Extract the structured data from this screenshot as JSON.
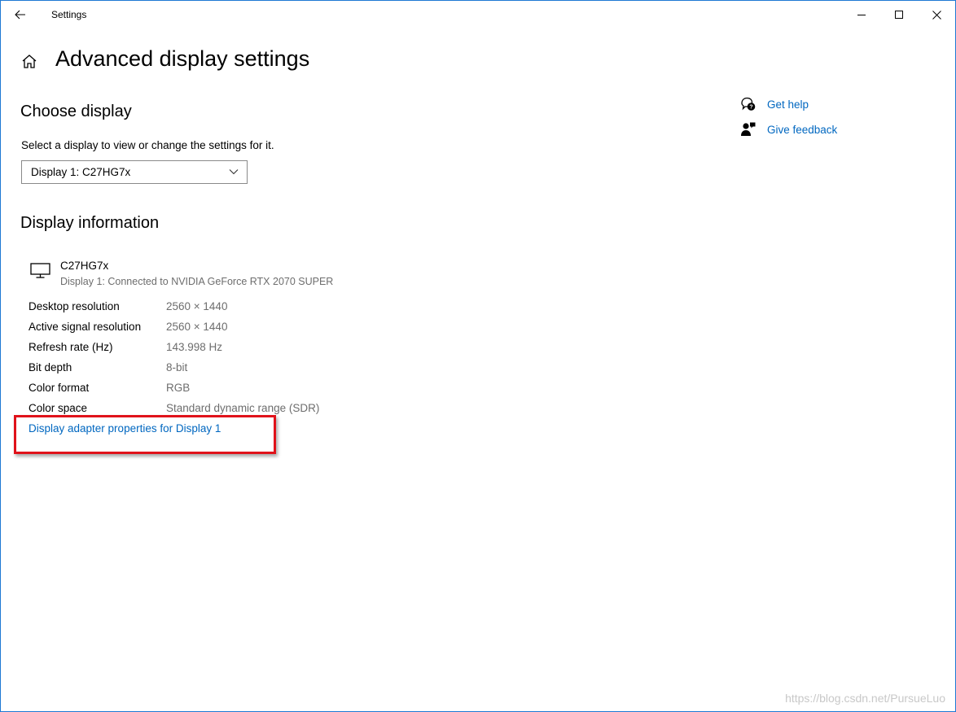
{
  "window": {
    "title": "Settings"
  },
  "page": {
    "title": "Advanced display settings"
  },
  "choose_display": {
    "heading": "Choose display",
    "description": "Select a display to view or change the settings for it.",
    "selected": "Display 1: C27HG7x"
  },
  "display_info": {
    "heading": "Display information",
    "monitor_name": "C27HG7x",
    "monitor_subtitle": "Display 1: Connected to NVIDIA GeForce RTX 2070 SUPER",
    "rows": [
      {
        "label": "Desktop resolution",
        "value": "2560 × 1440"
      },
      {
        "label": "Active signal resolution",
        "value": "2560 × 1440"
      },
      {
        "label": "Refresh rate (Hz)",
        "value": "143.998 Hz"
      },
      {
        "label": "Bit depth",
        "value": "8-bit"
      },
      {
        "label": "Color format",
        "value": "RGB"
      },
      {
        "label": "Color space",
        "value": "Standard dynamic range (SDR)"
      }
    ],
    "adapter_link": "Display adapter properties for Display 1"
  },
  "help": {
    "get_help": "Get help",
    "give_feedback": "Give feedback"
  },
  "watermark": "https://blog.csdn.net/PursueLuo",
  "colors": {
    "link": "#0067c0",
    "highlight_border": "#e0121a",
    "window_border": "#1e79d4"
  },
  "icons": {
    "back": "back-arrow-icon",
    "minimize": "minimize-icon",
    "maximize": "maximize-icon",
    "close": "close-icon",
    "home": "home-icon",
    "dropdown": "chevron-down-icon",
    "monitor": "monitor-icon",
    "help": "help-chat-icon",
    "feedback": "feedback-person-icon"
  }
}
